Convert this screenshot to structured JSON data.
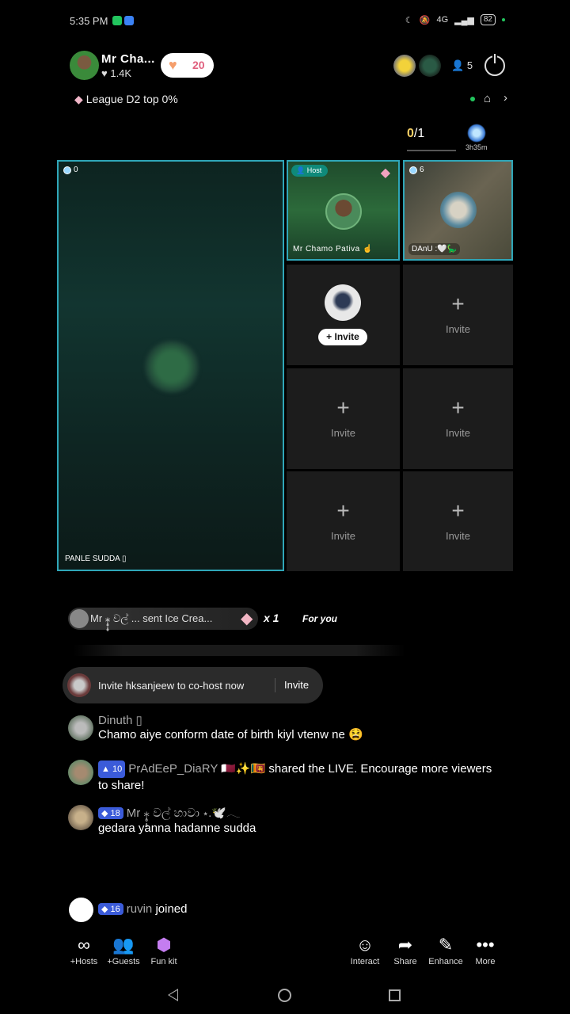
{
  "status_bar": {
    "time": "5:35 PM",
    "network": "4G",
    "battery": "82"
  },
  "header": {
    "host_name": "Mr Cha...",
    "host_likes": "1.4K",
    "gift_count": "20",
    "viewer_count": "5",
    "league": "League D2 top 0%"
  },
  "progress": {
    "current": "0",
    "total": "/1",
    "timer": "3h35m"
  },
  "grid": {
    "big_tile": {
      "badge": "0",
      "name": "PANLE SUDDA ▯"
    },
    "host_tile": {
      "badge": "Host",
      "name": "Mr Chamo Pativa"
    },
    "danu_tile": {
      "badge": "6",
      "name": "DAnU :🤍🦕"
    },
    "invite_button": "+ Invite",
    "empty_label": "Invite",
    "plus": "+"
  },
  "gift_strip": {
    "text": "Mr ⁎̣̥̣̥ වල් ... sent Ice Crea...",
    "multiplier": "x 1",
    "for_you": "For you"
  },
  "cohost_prompt": {
    "text": "Invite hksanjeew to co-host now",
    "button": "Invite"
  },
  "chat": [
    {
      "name": "Dinuth ▯",
      "level": "",
      "message": "Chamo aiye conform date of birth kiyl vtenw ne 😫"
    },
    {
      "name": "PrAdEeP_DiaRY 🇶🇦✨🇱🇰",
      "level": "10",
      "message": "shared the LIVE. Encourage more viewers to share!"
    },
    {
      "name": "Mr ⁎̣̥̣̥ වල් හාවා ⋆.🕊️𓂃",
      "level": "18",
      "message": "gedara yanna hadanne sudda"
    }
  ],
  "joined": {
    "level": "16",
    "name": "ruvin",
    "text": "joined"
  },
  "toolbar": {
    "hosts": "+Hosts",
    "guests": "+Guests",
    "funkit": "Fun kit",
    "interact": "Interact",
    "share": "Share",
    "enhance": "Enhance",
    "more": "More"
  },
  "colors": {
    "accent": "#2fa6b8",
    "level_badge": "#3b5bd9",
    "host_badge": "#0f8a7a"
  }
}
